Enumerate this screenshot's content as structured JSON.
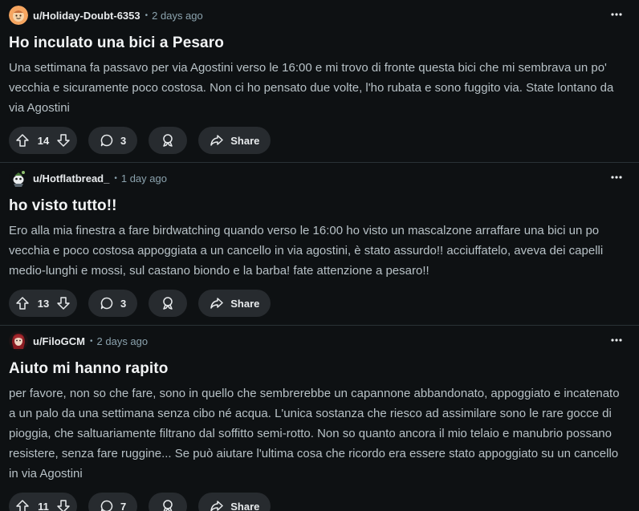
{
  "posts": [
    {
      "username": "u/Holiday-Doubt-6353",
      "time": "2 days ago",
      "title": "Ho inculato una bici a Pesaro",
      "body": "Una settimana fa passavo per via Agostini verso le 16:00 e mi trovo di fronte questa bici che mi sembrava un po' vecchia e sicuramente poco costosa. Non ci ho pensato due volte, l'ho rubata e sono fuggito via. State lontano da via Agostini",
      "votes": "14",
      "comments": "3",
      "share_label": "Share",
      "avatar_icon": "orange-snoo-avatar-icon"
    },
    {
      "username": "u/Hotflatbread_",
      "time": "1 day ago",
      "title": "ho visto tutto!!",
      "body": "Ero alla mia finestra a fare birdwatching quando verso le 16:00 ho visto un mascalzone arraffare una bici un po vecchia e poco costosa appoggiata a un cancello in via agostini, è stato assurdo!! acciuffatelo, aveva dei capelli medio-lunghi e mossi, sul castano biondo e la barba! fate attenzione a pesaro!!",
      "votes": "13",
      "comments": "3",
      "share_label": "Share",
      "avatar_icon": "snoo-character-avatar-icon"
    },
    {
      "username": "u/FiloGCM",
      "time": "2 days ago",
      "title": "Aiuto mi hanno rapito",
      "body": "per favore, non so che fare, sono in quello che sembrerebbe un capannone abbandonato, appoggiato e incatenato a un palo da una settimana senza cibo né acqua. L'unica sostanza che riesco ad assimilare sono le rare gocce di pioggia, che saltuariamente filtrano dal soffitto semi-rotto. Non so quanto ancora il mio telaio e manubrio possano resistere, senza fare ruggine... Se può aiutare l'ultima cosa che ricordo era essere stato appoggiato su un cancello in via Agostini",
      "votes": "11",
      "comments": "7",
      "share_label": "Share",
      "avatar_icon": "red-hair-avatar-icon"
    }
  ],
  "separator": "•",
  "colors": {
    "background": "#0e1113",
    "pill": "#272b2f",
    "meta_text": "#8ba2ad",
    "body_text": "#b7c1c6"
  }
}
